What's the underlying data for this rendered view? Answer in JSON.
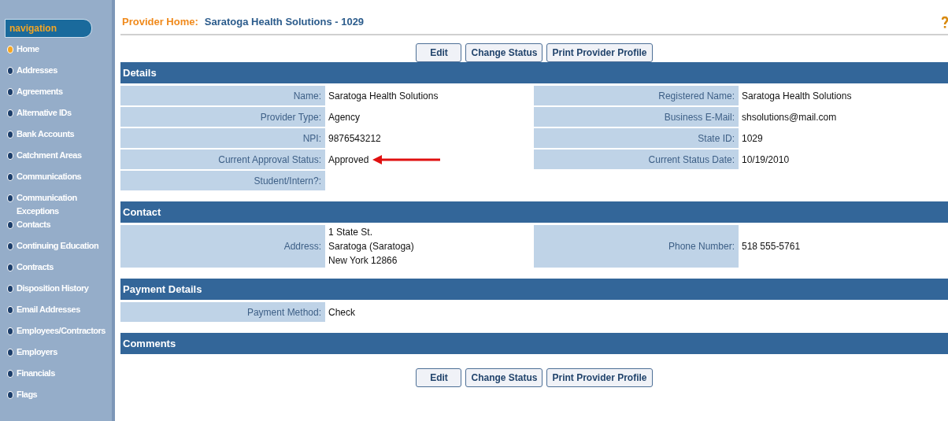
{
  "navigation": {
    "title": "navigation",
    "items": [
      {
        "label": "Home",
        "selected": true
      },
      {
        "label": "Addresses",
        "selected": false
      },
      {
        "label": "Agreements",
        "selected": false
      },
      {
        "label": "Alternative IDs",
        "selected": false
      },
      {
        "label": "Bank Accounts",
        "selected": false
      },
      {
        "label": "Catchment Areas",
        "selected": false
      },
      {
        "label": "Communications",
        "selected": false
      },
      {
        "label": "Communication Exceptions",
        "selected": false
      },
      {
        "label": "Contacts",
        "selected": false
      },
      {
        "label": "Continuing Education",
        "selected": false
      },
      {
        "label": "Contracts",
        "selected": false
      },
      {
        "label": "Disposition History",
        "selected": false
      },
      {
        "label": "Email Addresses",
        "selected": false
      },
      {
        "label": "Employees/Contractors",
        "selected": false
      },
      {
        "label": "Employers",
        "selected": false
      },
      {
        "label": "Financials",
        "selected": false
      },
      {
        "label": "Flags",
        "selected": false
      }
    ]
  },
  "header": {
    "label": "Provider Home:",
    "value": "Saratoga Health Solutions - 1029"
  },
  "buttons_top": [
    "Edit",
    "Change Status",
    "Print Provider Profile"
  ],
  "sections": [
    {
      "title": "Details",
      "rows": [
        {
          "left": {
            "label": "Name:",
            "lines": [
              "Saratoga Health Solutions"
            ]
          },
          "right": {
            "label": "Registered Name:",
            "lines": [
              "Saratoga Health Solutions"
            ]
          }
        },
        {
          "left": {
            "label": "Provider Type:",
            "lines": [
              "Agency"
            ]
          },
          "right": {
            "label": "Business E-Mail:",
            "lines": [
              "shsolutions@mail.com"
            ]
          }
        },
        {
          "left": {
            "label": "NPI:",
            "lines": [
              "9876543212"
            ]
          },
          "right": {
            "label": "State ID:",
            "lines": [
              "1029"
            ]
          }
        },
        {
          "left": {
            "label": "Current Approval Status:",
            "lines": [
              "Approved"
            ],
            "arrow": true
          },
          "right": {
            "label": "Current Status Date:",
            "lines": [
              "10/19/2010"
            ]
          }
        },
        {
          "left": {
            "label": "Student/Intern?:"
          }
        }
      ]
    },
    {
      "title": "Contact",
      "rows": [
        {
          "left": {
            "label": "Address:",
            "lines": [
              "1 State St.",
              "Saratoga (Saratoga)",
              "New York 12866"
            ]
          },
          "right": {
            "label": "Phone Number:",
            "lines": [
              "518 555-5761"
            ]
          }
        }
      ]
    },
    {
      "title": "Payment Details",
      "rows": [
        {
          "left": {
            "label": "Payment Method:",
            "lines": [
              "Check"
            ]
          }
        }
      ]
    },
    {
      "title": "Comments"
    }
  ],
  "buttons_bottom": [
    "Edit",
    "Change Status",
    "Print Provider Profile"
  ]
}
